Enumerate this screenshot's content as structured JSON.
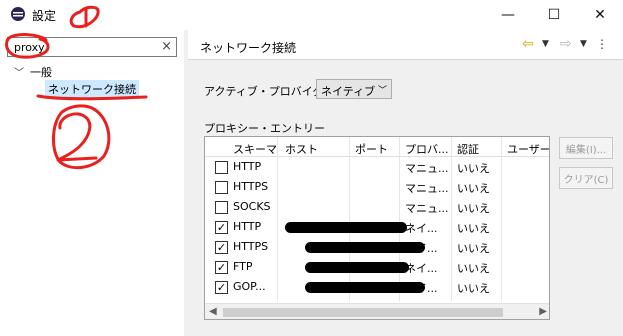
{
  "window": {
    "title": "設定",
    "icon": "eclipse-icon",
    "minimize_icon": "minimize-icon",
    "maximize_icon": "maximize-icon",
    "close_icon": "close-icon"
  },
  "filter": {
    "value": "proxy",
    "clear_icon": "clear-icon"
  },
  "tree": {
    "general": "一般",
    "network": "ネットワーク接続"
  },
  "page": {
    "title": "ネットワーク接続",
    "nav": [
      "back-arrow-icon",
      "forward-arrow-icon",
      "view-menu-icon"
    ]
  },
  "provider": {
    "label": "アクティブ・プロバイダー:",
    "value": "ネイティブ"
  },
  "entries": {
    "label": "プロキシー・エントリー",
    "columns": [
      "スキーマ",
      "ホスト",
      "ポート",
      "プロバ...",
      "認証",
      "ユーザー"
    ],
    "rows": [
      {
        "checked": false,
        "scheme": "HTTP",
        "provider": "マニュ...",
        "auth": "いいえ"
      },
      {
        "checked": false,
        "scheme": "HTTPS",
        "provider": "マニュ...",
        "auth": "いいえ"
      },
      {
        "checked": false,
        "scheme": "SOCKS",
        "provider": "マニュ...",
        "auth": "いいえ"
      },
      {
        "checked": true,
        "scheme": "HTTP",
        "provider": "ネイ...",
        "auth": "いいえ"
      },
      {
        "checked": true,
        "scheme": "HTTPS",
        "provider": "ネイ...",
        "auth": "いいえ"
      },
      {
        "checked": true,
        "scheme": "FTP",
        "provider": "ネイ...",
        "auth": "いいえ"
      },
      {
        "checked": true,
        "scheme": "GOP...",
        "provider": "ネイ...",
        "auth": "いいえ"
      }
    ]
  },
  "buttons": {
    "edit": "編集(I)...",
    "clear": "クリア(C)"
  },
  "annotation_colors": {
    "marker": "#e8201e"
  }
}
